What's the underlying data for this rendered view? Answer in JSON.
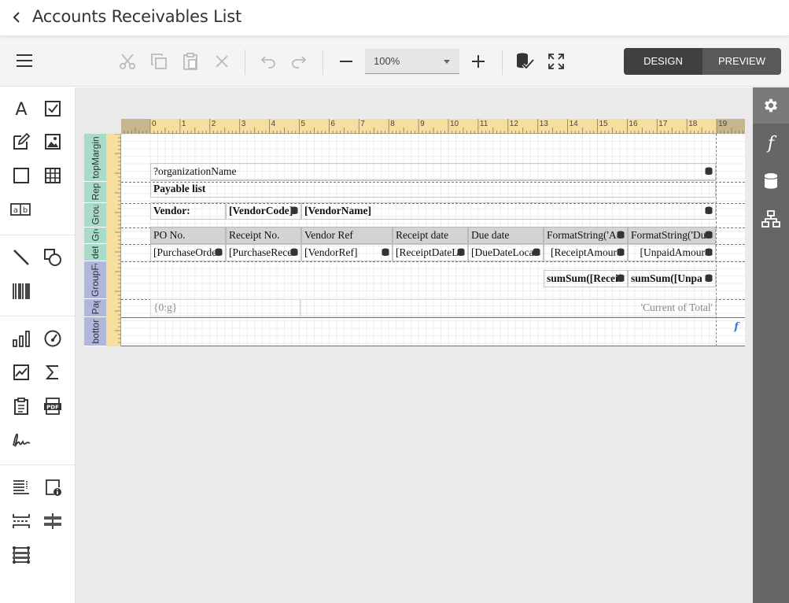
{
  "header": {
    "title": "Accounts Receivables List"
  },
  "toolbar": {
    "zoom_value": "100%",
    "mode_design": "DESIGN",
    "mode_preview": "PREVIEW"
  },
  "ruler": {
    "numbers": [
      "0",
      "1",
      "2",
      "3",
      "4",
      "5",
      "6",
      "7",
      "8",
      "9",
      "10",
      "11",
      "12",
      "13",
      "14",
      "15",
      "16",
      "17",
      "18",
      "19"
    ]
  },
  "bands": [
    {
      "name": "topMargin"
    },
    {
      "name": "ReportHeader"
    },
    {
      "name": "GroupHeader"
    },
    {
      "name": "GroupHeader"
    },
    {
      "name": "detail"
    },
    {
      "name": "GroupFooter"
    },
    {
      "name": "PageFooter"
    },
    {
      "name": "bottomMargin"
    }
  ],
  "report": {
    "org_name": "?organizationName",
    "payable_list": "Payable list",
    "vendor_label": "Vendor:",
    "vendor_code": "[VendorCode]",
    "vendor_name": "[VendorName]",
    "columns": [
      "PO No.",
      "Receipt No.",
      "Vendor Ref",
      "Receipt date",
      "Due date",
      "FormatString('A",
      "FormatString('Du"
    ],
    "detail": [
      "[PurchaseOrde",
      "[PurchaseRece",
      "[VendorRef]",
      "[ReceiptDateL",
      "[DueDateLoca",
      "[ReceiptAmour",
      "[UnpaidAmour"
    ],
    "footer_sums": [
      "sumSum([Recei",
      "sumSum([Unpa"
    ],
    "page_number": "{0:g}",
    "current_total": "'Current of Total'"
  },
  "colors": {
    "accent": "#404040",
    "ruler": "#f5dea0",
    "band_green": "#a8dcc9",
    "band_blue": "#b1b7dc"
  }
}
